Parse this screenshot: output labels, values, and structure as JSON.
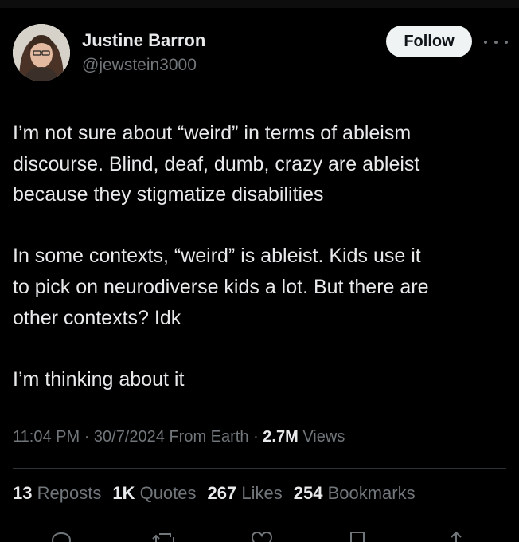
{
  "author": {
    "name": "Justine Barron",
    "handle": "@jewstein3000",
    "avatar_icon": "avatar"
  },
  "follow_label": "Follow",
  "more_icon": "more-horizontal-icon",
  "tweet": {
    "paragraphs": [
      "I’m not sure about “weird” in terms of ableism\ndiscourse. Blind, deaf, dumb, crazy are ableist\nbecause they stigmatize disabilities",
      "In some contexts, “weird” is ableist. Kids use it\nto pick on neurodiverse kids a lot. But there are\nother contexts? Idk",
      "I’m thinking about it"
    ]
  },
  "meta": {
    "time": "11:04 PM",
    "date": "30/7/2024",
    "source": "From Earth",
    "views_count": "2.7M",
    "views_label": "Views",
    "separator": "·"
  },
  "stats": {
    "reposts_count": "13",
    "reposts_label": "Reposts",
    "quotes_count": "1K",
    "quotes_label": "Quotes",
    "likes_count": "267",
    "likes_label": "Likes",
    "bookmarks_count": "254",
    "bookmarks_label": "Bookmarks"
  },
  "actions": [
    "reply-icon",
    "repost-icon",
    "like-icon",
    "bookmark-icon",
    "share-icon"
  ],
  "colors": {
    "background": "#000000",
    "primary_text": "#e7e9ea",
    "secondary_text": "#71767b",
    "follow_button_bg": "#eff3f4",
    "divider": "#2f3336"
  }
}
